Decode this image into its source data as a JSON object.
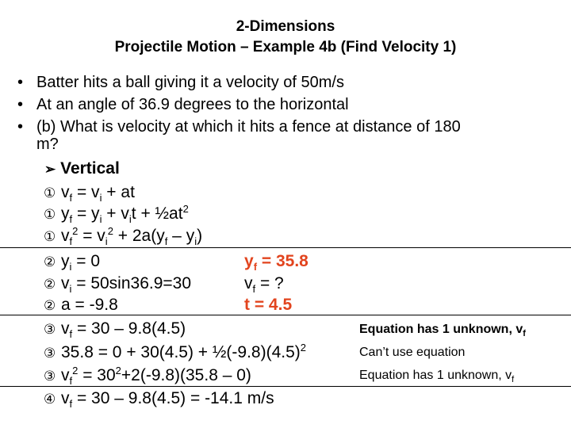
{
  "title": {
    "line1": "2-Dimensions",
    "line2": "Projectile Motion – Example 4b (Find Velocity 1)"
  },
  "bullets": [
    {
      "marker": "•",
      "text": "Batter hits a ball giving it a velocity of 50m/s"
    },
    {
      "marker": "•",
      "text": "At an angle of 36.9 degrees to the horizontal"
    },
    {
      "marker": "•",
      "text": "(b)  What is velocity at which it hits a fence at distance of 180",
      "continuation": "m?"
    }
  ],
  "section": {
    "marker": "➢",
    "label": "Vertical"
  },
  "steps": {
    "step1_marker": "①",
    "step2_marker": "②",
    "step3_marker": "③",
    "step4_marker": "④"
  },
  "equations": {
    "eq1": {
      "a": "v",
      "a_sub": "f",
      "b": " = v",
      "b_sub": "i",
      "c": " + at"
    },
    "eq2": {
      "a": "y",
      "a_sub": "f",
      "b": " = y",
      "b_sub": "i",
      "c": " + v",
      "c_sub": "i",
      "d": "t + ½at",
      "d_sup": "2"
    },
    "eq3": {
      "a": "v",
      "a_sub": "f",
      "a_sup": "2",
      "b": " = v",
      "b_sub": "i",
      "b_sup": "2",
      "c": " + 2a(y",
      "c_sub": "f",
      "d": " – y",
      "d_sub": "i",
      "e": ")"
    }
  },
  "knowns": {
    "yi": {
      "a": "y",
      "a_sub": "i",
      "b": " = 0"
    },
    "vi": {
      "a": "v",
      "a_sub": "i",
      "b": " = 50sin36.9=30"
    },
    "a": {
      "a": "a = -9.8"
    },
    "yf": {
      "a": "y",
      "a_sub": "f",
      "b": " = 35.8"
    },
    "vf": {
      "a": "v",
      "a_sub": "f",
      "b": " = ?"
    },
    "t": {
      "a": "t = 4.5"
    }
  },
  "substitutions": {
    "s1": {
      "a": "v",
      "a_sub": "f",
      "b": " = 30 – 9.8(4.5)"
    },
    "s2": {
      "a": "35.8 = 0 + 30(4.5) + ½(-9.8)(4.5)",
      "a_sup": "2"
    },
    "s3": {
      "a": "v",
      "a_sub": "f",
      "a_sup": "2",
      "b": " = 30",
      "b_sup": "2",
      "c": "+2(-9.8)(35.8 – 0)"
    }
  },
  "notes": {
    "n1": {
      "a": "Equation has 1 unknown,  v",
      "a_sub": "f"
    },
    "n2": {
      "a": "Can’t use equation"
    },
    "n3": {
      "a": "Equation has 1 unknown, v",
      "a_sub": "f"
    }
  },
  "answer": {
    "a": "v",
    "a_sub": "f",
    "b": " = 30 – 9.8(4.5) = -14.1 m/s"
  },
  "colors": {
    "highlight": "#e2441e",
    "text": "#000000",
    "background": "#ffffff"
  }
}
